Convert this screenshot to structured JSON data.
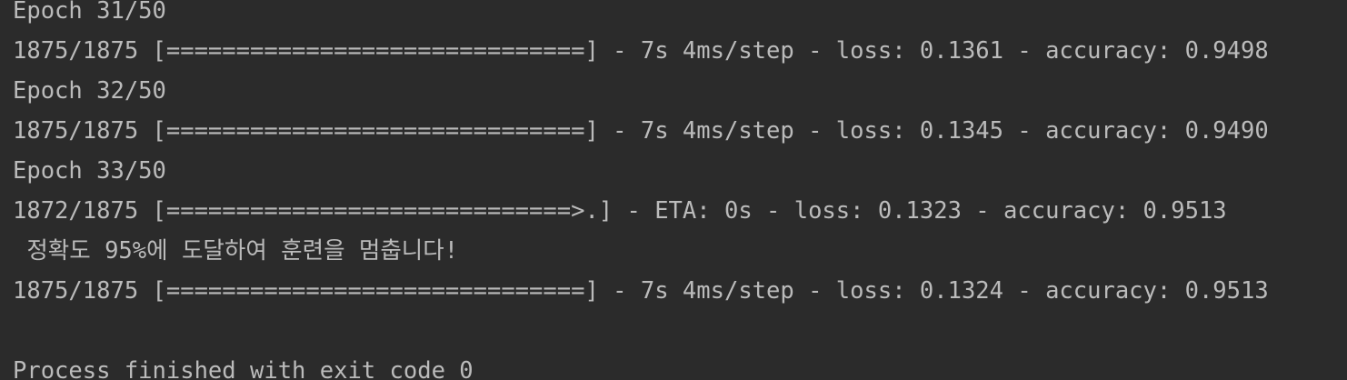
{
  "console": {
    "lines": [
      "Epoch 31/50",
      "1875/1875 [==============================] - 7s 4ms/step - loss: 0.1361 - accuracy: 0.9498",
      "Epoch 32/50",
      "1875/1875 [==============================] - 7s 4ms/step - loss: 0.1345 - accuracy: 0.9490",
      "Epoch 33/50",
      "1872/1875 [=============================>.] - ETA: 0s - loss: 0.1323 - accuracy: 0.9513",
      " 정확도 95%에 도달하여 훈련을 멈춥니다!",
      "1875/1875 [==============================] - 7s 4ms/step - loss: 0.1324 - accuracy: 0.9513",
      "",
      "Process finished with exit code 0"
    ]
  },
  "colors": {
    "background": "#2b2b2b",
    "text": "#bbbbbb"
  }
}
